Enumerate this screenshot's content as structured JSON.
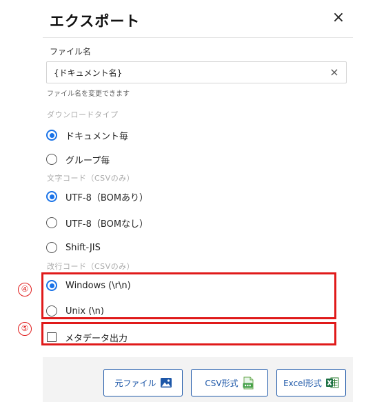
{
  "dialog": {
    "title": "エクスポート",
    "close_symbol": "×"
  },
  "filename": {
    "label": "ファイル名",
    "value": "{ドキュメント名}",
    "clear_symbol": "×",
    "helper": "ファイル名を変更できます"
  },
  "download_type": {
    "label": "ダウンロードタイプ",
    "options": [
      {
        "label": "ドキュメント毎",
        "selected": true
      },
      {
        "label": "グループ毎",
        "selected": false
      }
    ]
  },
  "encoding": {
    "label": "文字コード（CSVのみ）",
    "options": [
      {
        "label": "UTF-8（BOMあり）",
        "selected": true
      },
      {
        "label": "UTF-8（BOMなし）",
        "selected": false
      },
      {
        "label": "Shift-JIS",
        "selected": false
      }
    ]
  },
  "newline": {
    "label": "改行コード（CSVのみ）",
    "options": [
      {
        "label": "Windows (\\r\\n)",
        "selected": true
      },
      {
        "label": "Unix (\\n)",
        "selected": false
      }
    ]
  },
  "metadata_checkbox": {
    "label": "メタデータ出力",
    "checked": false
  },
  "annotations": {
    "marker_4": "④",
    "marker_5": "⑤",
    "color": "#e01a1a"
  },
  "buttons": {
    "original": {
      "label": "元ファイル",
      "icon": "image-icon"
    },
    "csv": {
      "label": "CSV形式",
      "icon": "csv-file-icon"
    },
    "excel": {
      "label": "Excel形式",
      "icon": "excel-icon"
    }
  },
  "colors": {
    "accent": "#1a73e8",
    "button_border": "#1d57a8",
    "footer_bg": "#f3f3f3"
  }
}
